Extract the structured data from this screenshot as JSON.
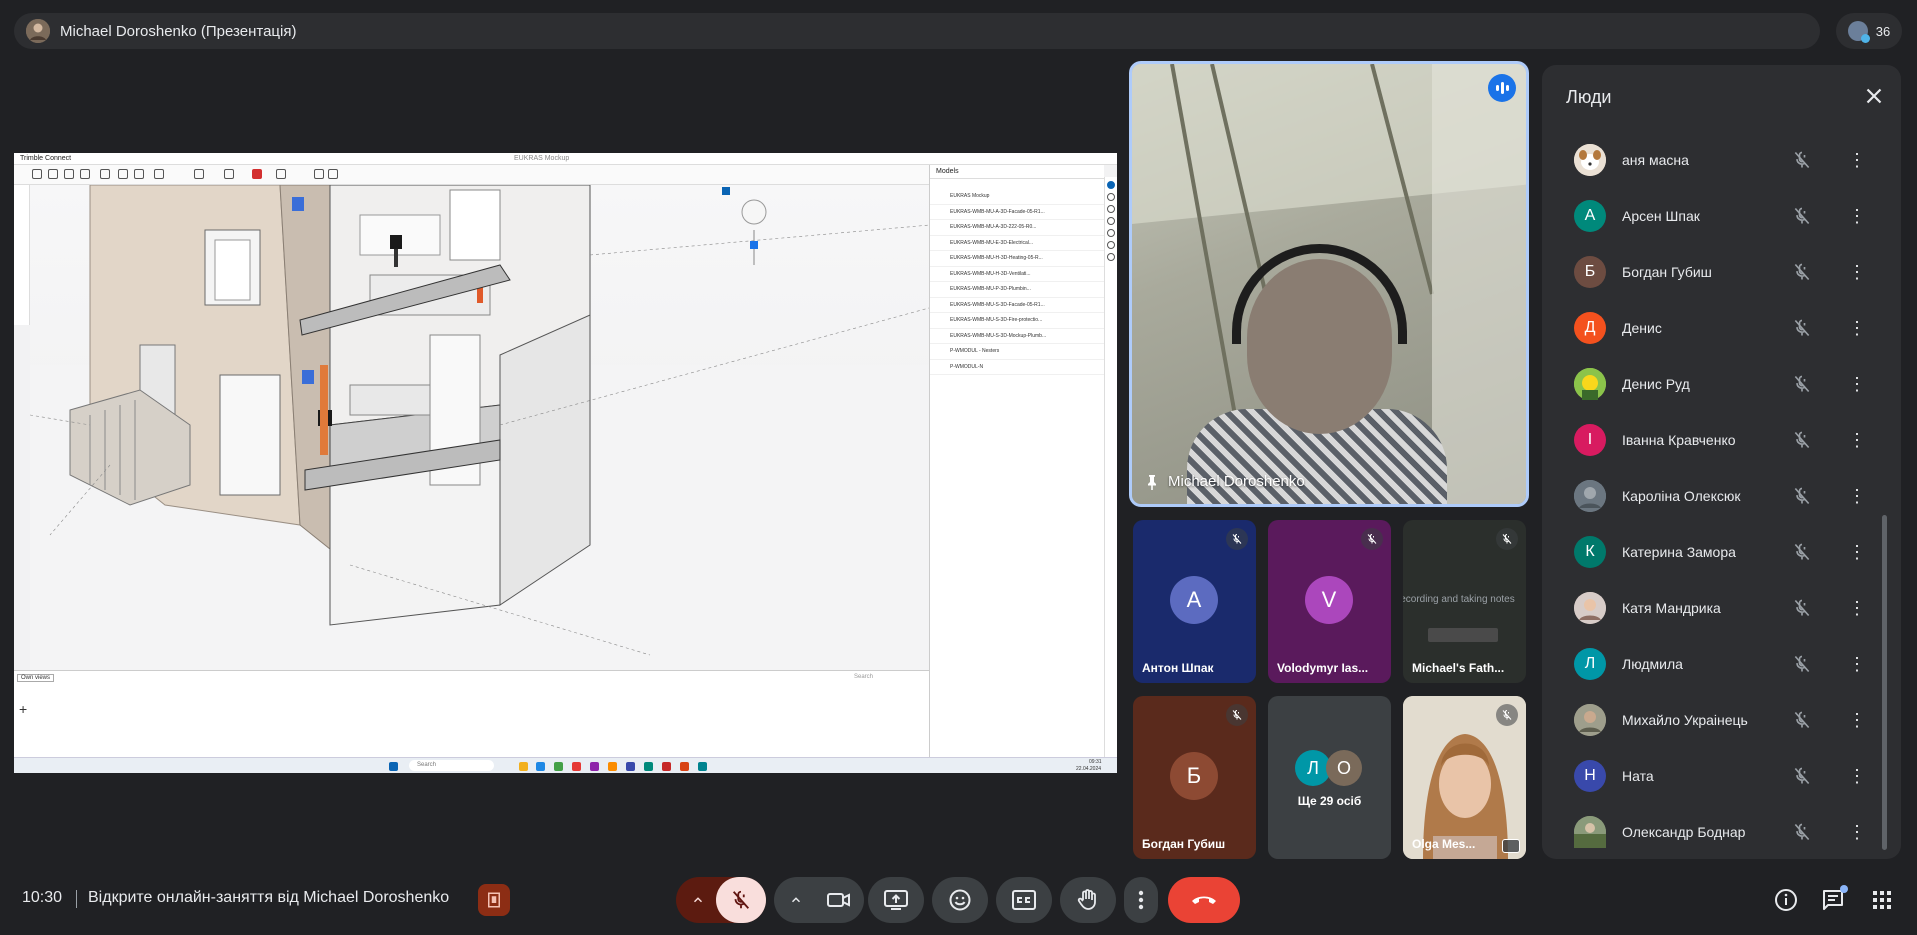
{
  "topbar": {
    "title": "Michael Doroshenko (Презентація)",
    "participant_count": "36"
  },
  "presentation": {
    "app_name": "Trimble Connect",
    "window_title": "EUKRAS Mockup",
    "models_header": "Models",
    "model_rows": [
      "EUKRAS Mockup",
      "EUKRAS-WMB-MU-A-3D-Facade-05-R1...",
      "EUKRAS-WMB-MU-A-3D-222-05-R0...",
      "EUKRAS-WMB-MU-E-3D-Electrical...",
      "EUKRAS-WMB-MU-H-3D-Heating-05-R...",
      "EUKRAS-WMB-MU-H-3D-Ventilati...",
      "EUKRAS-WMB-MU-P-3D-Plumbin...",
      "EUKRAS-WMB-MU-S-3D-Facade-05-R1...",
      "EUKRAS-WMB-MU-S-3D-Fire-protectio...",
      "EUKRAS-WMB-MU-S-3D-Mockup-Plumb...",
      "P-WMODUL - Nesters",
      "P-WMODUL-N"
    ],
    "bottom_dropdown": "Own views",
    "search_placeholder": "Search",
    "taskbar_search": "Search",
    "clock_time": "09:31",
    "clock_date": "22.04.2024"
  },
  "main_speaker": {
    "name": "Michael Doroshenko"
  },
  "tiles": [
    {
      "initial": "А",
      "name": "Антон Шпак",
      "bg": "#1a2a6c",
      "av": "#5c6bc0"
    },
    {
      "initial": "V",
      "name": "Volodymyr Ias...",
      "bg": "#5a1a5c",
      "av": "#ab47bc"
    },
    {
      "initial": "",
      "name": "Michael's Fath...",
      "bg": "#2b2f2c",
      "av": "",
      "caption": "Recording and taking notes"
    },
    {
      "initial": "Б",
      "name": "Богдан Губиш",
      "bg": "#5a2a1c",
      "av": "#8d4a33"
    },
    {
      "initial": "",
      "name": "Olga Mes...",
      "bg": "#d9d2c4",
      "av": ""
    }
  ],
  "more_tile": {
    "initials": [
      "Л",
      "О"
    ],
    "label": "Ще 29 осіб"
  },
  "people_panel": {
    "title": "Люди",
    "people": [
      {
        "initial": "",
        "name": "аня масна",
        "color": "#c8a27a"
      },
      {
        "initial": "А",
        "name": "Арсен Шпак",
        "color": "#00897b"
      },
      {
        "initial": "Б",
        "name": "Богдан Губиш",
        "color": "#6d4c41"
      },
      {
        "initial": "Д",
        "name": "Денис",
        "color": "#f4511e"
      },
      {
        "initial": "",
        "name": "Денис Руд",
        "color": "#9ccc65"
      },
      {
        "initial": "І",
        "name": "Іванна Кравченко",
        "color": "#d81b60"
      },
      {
        "initial": "",
        "name": "Кароліна Олексюк",
        "color": "#78909c"
      },
      {
        "initial": "К",
        "name": "Катерина Замора",
        "color": "#00796b"
      },
      {
        "initial": "",
        "name": "Катя Мандрика",
        "color": "#bcaaa4"
      },
      {
        "initial": "Л",
        "name": "Людмила",
        "color": "#0097a7"
      },
      {
        "initial": "",
        "name": "Михайло Украінець",
        "color": "#8d8d7a"
      },
      {
        "initial": "Н",
        "name": "Ната",
        "color": "#3949ab"
      },
      {
        "initial": "",
        "name": "Олександр Боднар",
        "color": "#7a8a6a"
      }
    ]
  },
  "bottom_bar": {
    "time": "10:30",
    "meeting_title": "Відкрите онлайн-заняття від Michael Doroshenko"
  },
  "colors": {
    "leave_red": "#ea4335",
    "mic_off_bg": "#f9dedc",
    "accent_blue": "#8ab4f8",
    "recording": "#8c2d14"
  }
}
